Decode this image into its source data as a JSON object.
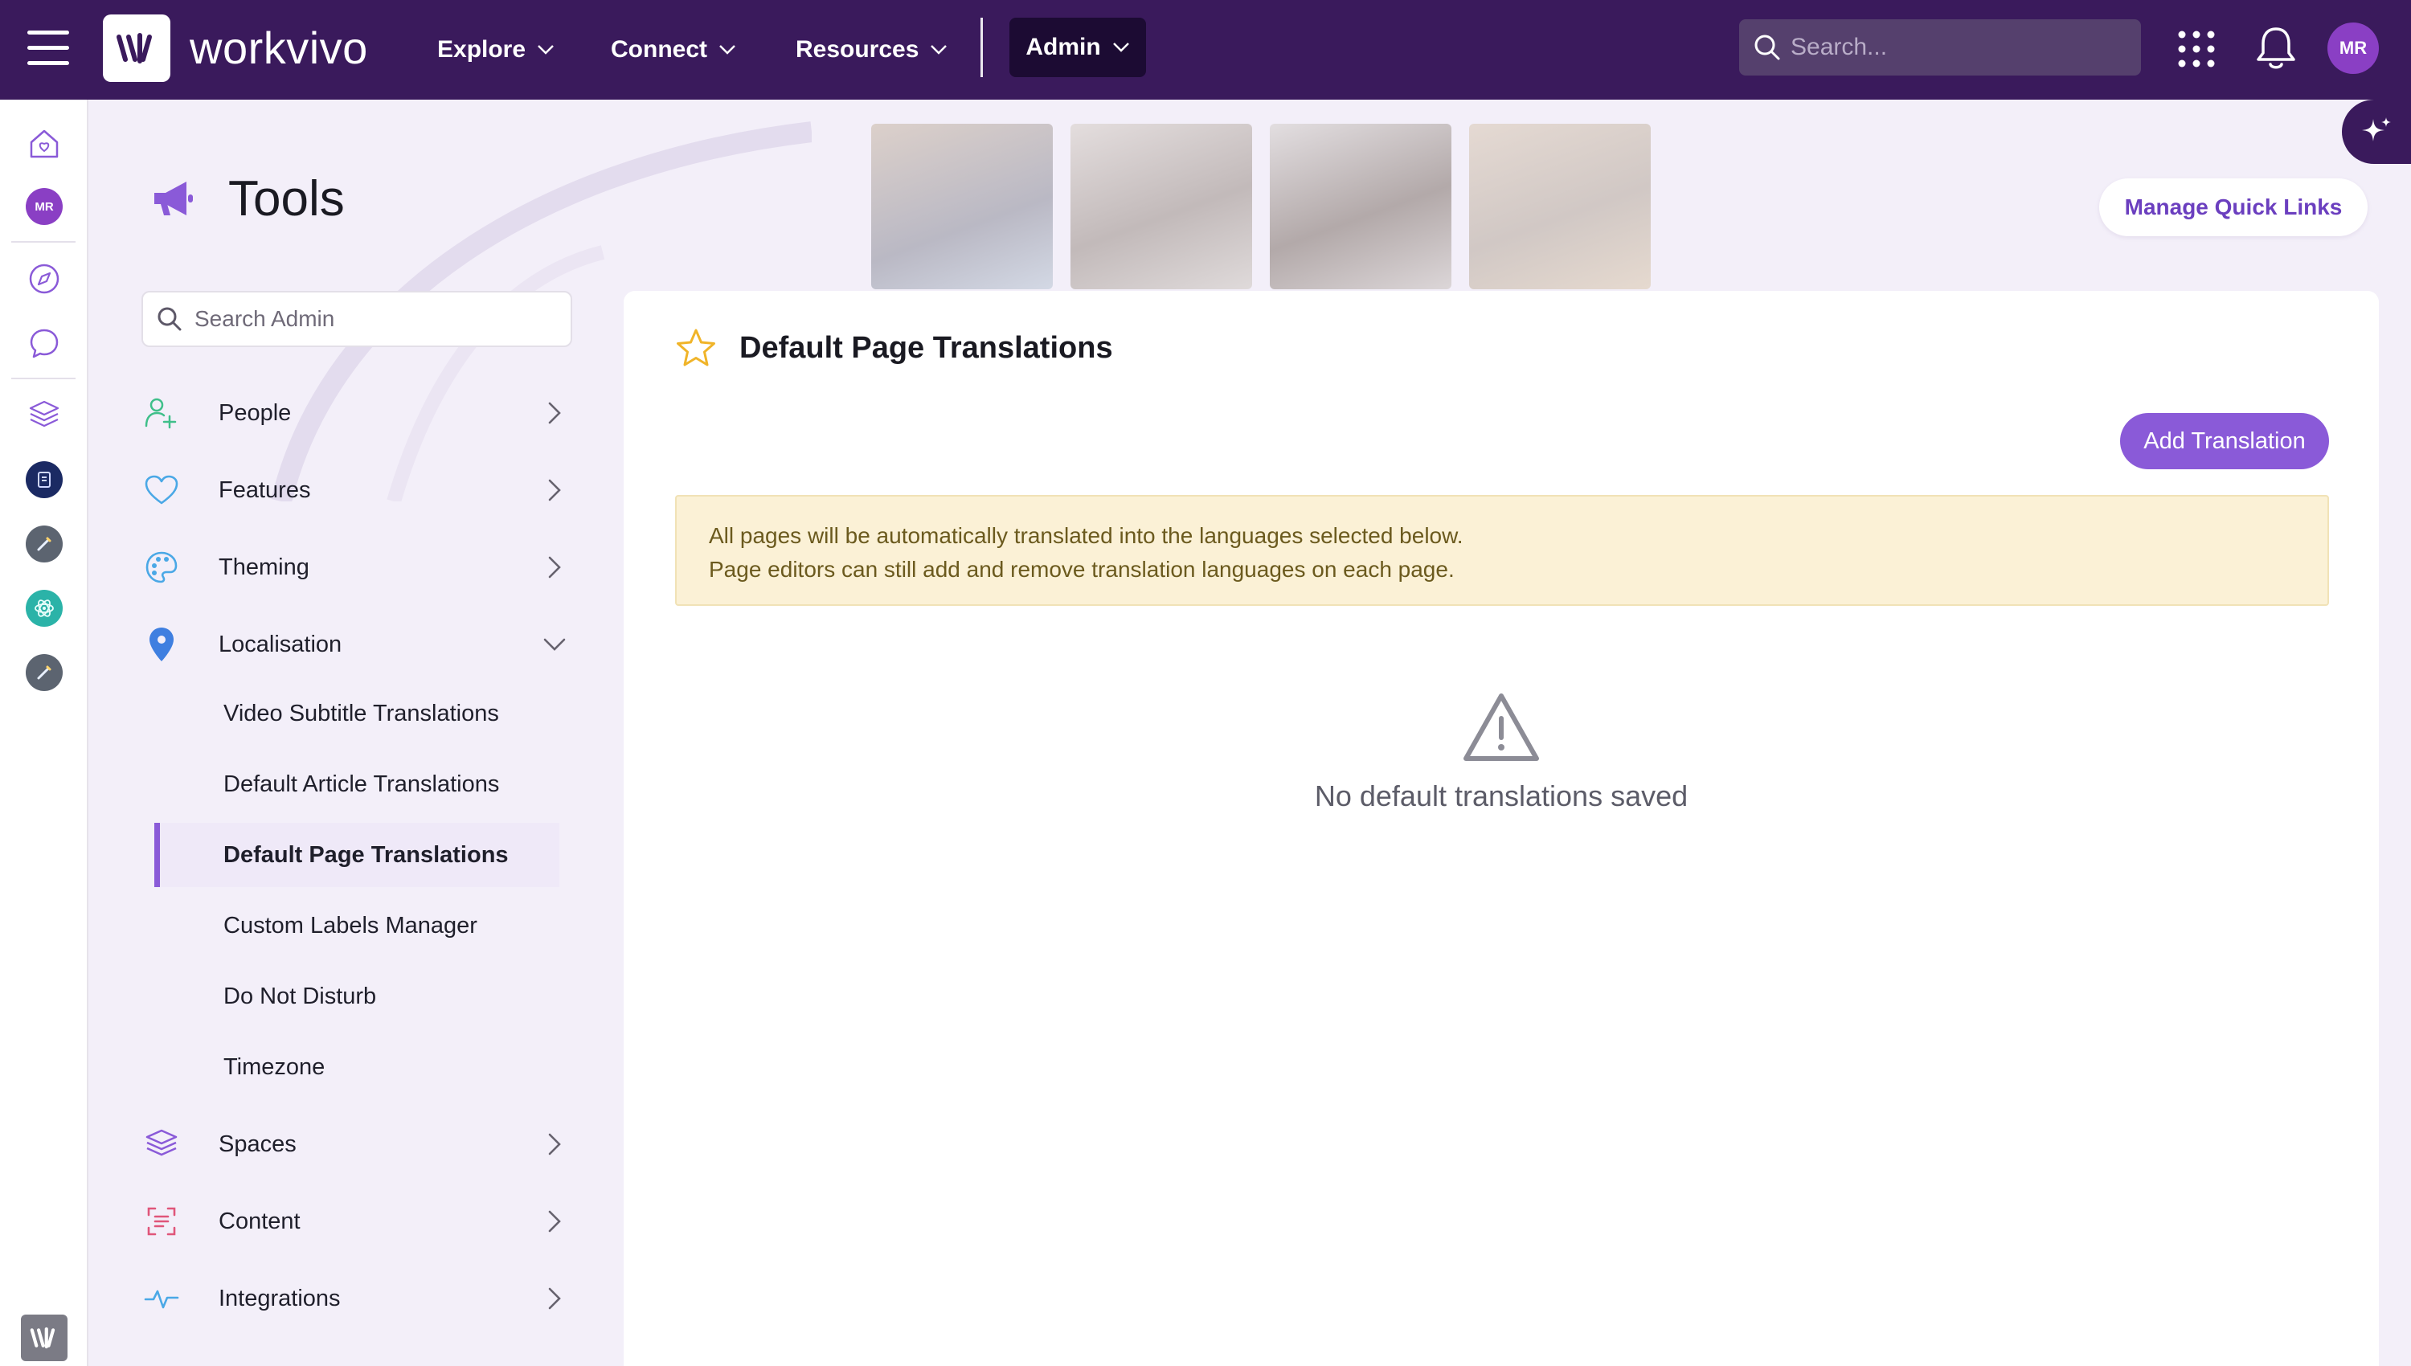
{
  "topbar": {
    "brand": "workvivo",
    "nav": [
      {
        "label": "Explore"
      },
      {
        "label": "Connect"
      },
      {
        "label": "Resources"
      }
    ],
    "admin_label": "Admin",
    "search_placeholder": "Search...",
    "user_initials": "MR"
  },
  "rail": {
    "user_initials": "MR"
  },
  "header": {
    "title": "Tools",
    "quick_links_label": "Manage Quick Links"
  },
  "admin_menu": {
    "search_placeholder": "Search Admin",
    "items": [
      {
        "label": "People"
      },
      {
        "label": "Features"
      },
      {
        "label": "Theming"
      },
      {
        "label": "Localisation"
      }
    ],
    "localisation_sub": [
      {
        "label": "Video Subtitle Translations"
      },
      {
        "label": "Default Article Translations"
      },
      {
        "label": "Default Page Translations"
      },
      {
        "label": "Custom Labels Manager"
      },
      {
        "label": "Do Not Disturb"
      },
      {
        "label": "Timezone"
      }
    ],
    "items_after": [
      {
        "label": "Spaces"
      },
      {
        "label": "Content"
      },
      {
        "label": "Integrations"
      }
    ]
  },
  "main": {
    "title": "Default Page Translations",
    "add_button": "Add Translation",
    "notice_line1": "All pages will be automatically translated into the languages selected below.",
    "notice_line2": "Page editors can still add and remove translation languages on each page.",
    "empty_text": "No default translations saved"
  },
  "colors": {
    "topbar": "#3a1a5c",
    "accent": "#8a5ad8",
    "notice_bg": "#fbf1d6"
  }
}
